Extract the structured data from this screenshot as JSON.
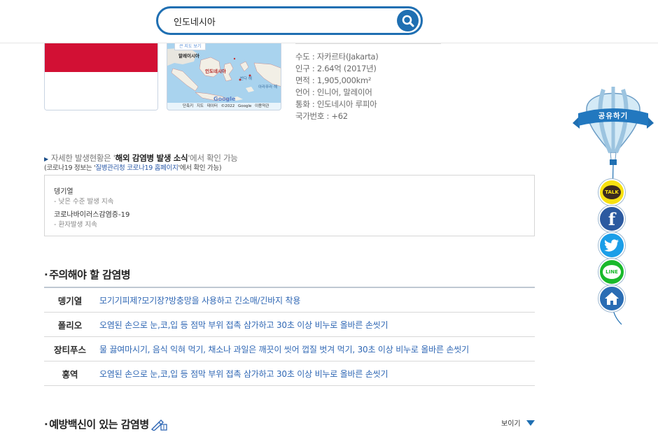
{
  "search": {
    "value": "인도네시아"
  },
  "map": {
    "button": "큰 지도 보기",
    "label_malaysia": "말레이시아",
    "label_indonesia": "인도네시아",
    "label_banda": "반다 해",
    "label_arafura": "아라푸라 해",
    "google": "Google",
    "footer_shortcut": "단축키",
    "footer_data": "지도 데이터 ©2022 Google",
    "footer_terms": "이용약관"
  },
  "country_info": [
    "수도 : 자카르타(Jakarta)",
    "인구 : 2.64억 (2017년)",
    "면적 : 1,905,000km²",
    "언어 : 인니어, 말레이어",
    "통화 : 인도네시아 루피아",
    "국가번호 : +62"
  ],
  "notice": {
    "line1_pre": "자세한 발생현황은 '",
    "line1_bold": "해외 감염병 발생 소식",
    "line1_post": "'에서 확인 가능",
    "line2_pre": "(코로나19 정보는 '",
    "line2_link": "질병관리청 코로나19 홈페이지",
    "line2_post": "'에서 확인 가능)"
  },
  "outbreaks": [
    {
      "name": "뎅기열",
      "status": "- 낮은 수준 발생 지속"
    },
    {
      "name": "코로나바이러스감염증-19",
      "status": "- 환자발생 지속"
    }
  ],
  "caution_section": {
    "title": "주의해야 할 감염병",
    "rows": [
      {
        "name": "뎅기열",
        "desc": "모기기피제?모기장?방충망을 사용하고 긴소매/긴바지 착용"
      },
      {
        "name": "폴리오",
        "desc": "오염된 손으로 눈,코,입 등 점막 부위 접촉 삼가하고 30초 이상 비누로 올바른 손씻기"
      },
      {
        "name": "장티푸스",
        "desc": "물 끓여마시기, 음식 익혀 먹기, 채소나 과일은 깨끗이 씻어 껍질 벗겨 먹기, 30초 이상 비누로 올바른 손씻기"
      },
      {
        "name": "홍역",
        "desc": "오염된 손으로 눈,코,입 등 점막 부위 접촉 삼가하고 30초 이상 비누로 올바른 손씻기"
      }
    ]
  },
  "vaccine_section": {
    "title": "예방백신이 있는 감염병",
    "toggle": "보이기"
  },
  "share": {
    "title": "공유하기",
    "talk": "TALK",
    "line": "LINE"
  },
  "colors": {
    "accent": "#1f6fb2",
    "flag_red": "#d21034",
    "link": "#2f67b4"
  }
}
